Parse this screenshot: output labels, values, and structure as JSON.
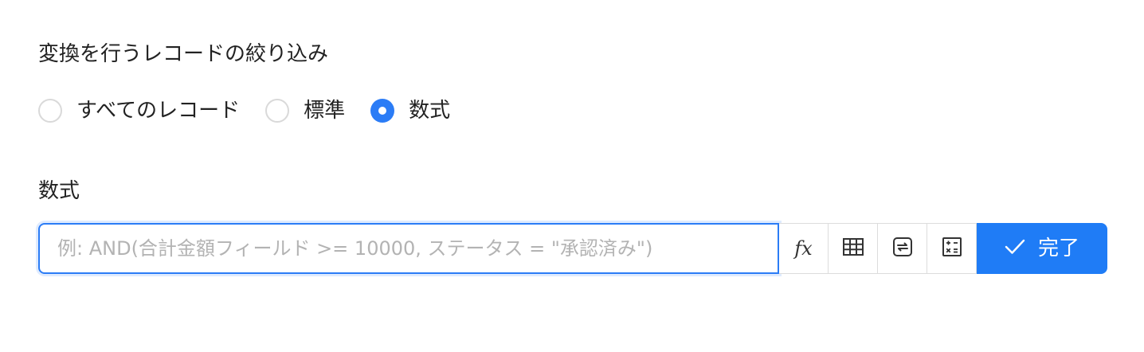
{
  "filter": {
    "title": "変換を行うレコードの絞り込み",
    "options": [
      {
        "label": "すべてのレコード",
        "checked": false
      },
      {
        "label": "標準",
        "checked": false
      },
      {
        "label": "数式",
        "checked": true
      }
    ]
  },
  "formula": {
    "label": "数式",
    "value": "",
    "placeholder": "例: AND(合計金額フィールド >= 10000, ステータス = \"承認済み\")",
    "tools": [
      {
        "icon": "function-icon",
        "text": "fx"
      },
      {
        "icon": "table-icon"
      },
      {
        "icon": "refresh-icon"
      },
      {
        "icon": "calculator-icon"
      }
    ],
    "done_label": "完了",
    "done_icon": "check-icon"
  },
  "colors": {
    "accent": "#1f7cf6",
    "border": "#dcdcdc",
    "placeholder": "#b3b3b3"
  }
}
